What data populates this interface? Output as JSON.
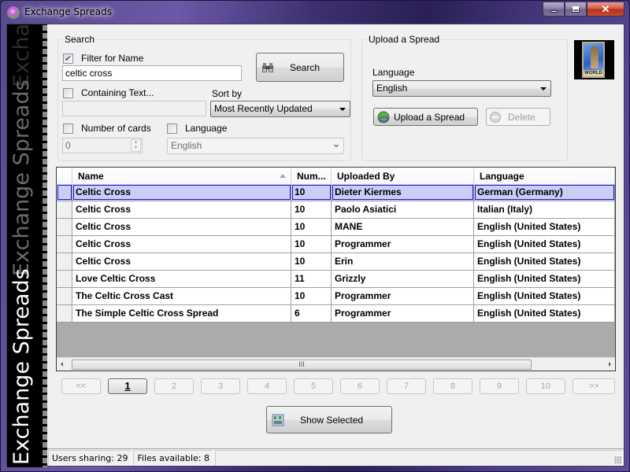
{
  "window": {
    "title": "Exchange Spreads",
    "buttons": {
      "minimize": "minimize",
      "maximize": "maximize",
      "close": "✕"
    }
  },
  "sidebar": {
    "banner_text": "Exchange Spreads"
  },
  "search": {
    "group_label": "Search",
    "filter_name": {
      "label": "Filter for Name",
      "checked": true,
      "value": "celtic cross"
    },
    "search_button": "Search",
    "containing_text": {
      "label": "Containing Text...",
      "checked": false,
      "value": ""
    },
    "sort_by": {
      "label": "Sort by",
      "selected": "Most Recently Updated"
    },
    "number_of_cards": {
      "label": "Number of cards",
      "checked": false,
      "value": "0"
    },
    "language": {
      "label": "Language",
      "checked": false,
      "selected": "English"
    }
  },
  "upload": {
    "group_label": "Upload a Spread",
    "language_label": "Language",
    "language_selected": "English",
    "upload_button": "Upload a Spread",
    "delete_button": "Delete"
  },
  "deck_image": {
    "caption": "WORLD"
  },
  "grid": {
    "columns": [
      "Name",
      "Num...",
      "Uploaded By",
      "Language"
    ],
    "sorted_column": "Name",
    "selected_row": 0,
    "rows": [
      {
        "name": "Celtic Cross",
        "num": "10",
        "uploaded_by": "Dieter Kiermes",
        "language": "German (Germany)"
      },
      {
        "name": "Celtic Cross",
        "num": "10",
        "uploaded_by": "Paolo Asiatici",
        "language": "Italian (Italy)"
      },
      {
        "name": "Celtic Cross",
        "num": "10",
        "uploaded_by": "MANE",
        "language": "English (United States)"
      },
      {
        "name": "Celtic Cross",
        "num": "10",
        "uploaded_by": "Programmer",
        "language": "English (United States)"
      },
      {
        "name": "Celtic Cross",
        "num": "10",
        "uploaded_by": "Erin",
        "language": "English (United States)"
      },
      {
        "name": "Love Celtic Cross",
        "num": "11",
        "uploaded_by": "Grizzly",
        "language": "English (United States)"
      },
      {
        "name": "The Celtic Cross Cast",
        "num": "10",
        "uploaded_by": "Programmer",
        "language": "English (United States)"
      },
      {
        "name": "The Simple Celtic Cross Spread",
        "num": "6",
        "uploaded_by": "Programmer",
        "language": "English (United States)"
      }
    ],
    "scroll_thumb_glyph": "III"
  },
  "pager": {
    "pages": [
      "<<",
      "1",
      "2",
      "3",
      "4",
      "5",
      "6",
      "7",
      "8",
      "9",
      "10",
      ">>"
    ],
    "current_page": "1"
  },
  "show_selected_button": "Show Selected",
  "status": {
    "users_sharing": "Users sharing: 29",
    "files_available": "Files available: 8"
  }
}
